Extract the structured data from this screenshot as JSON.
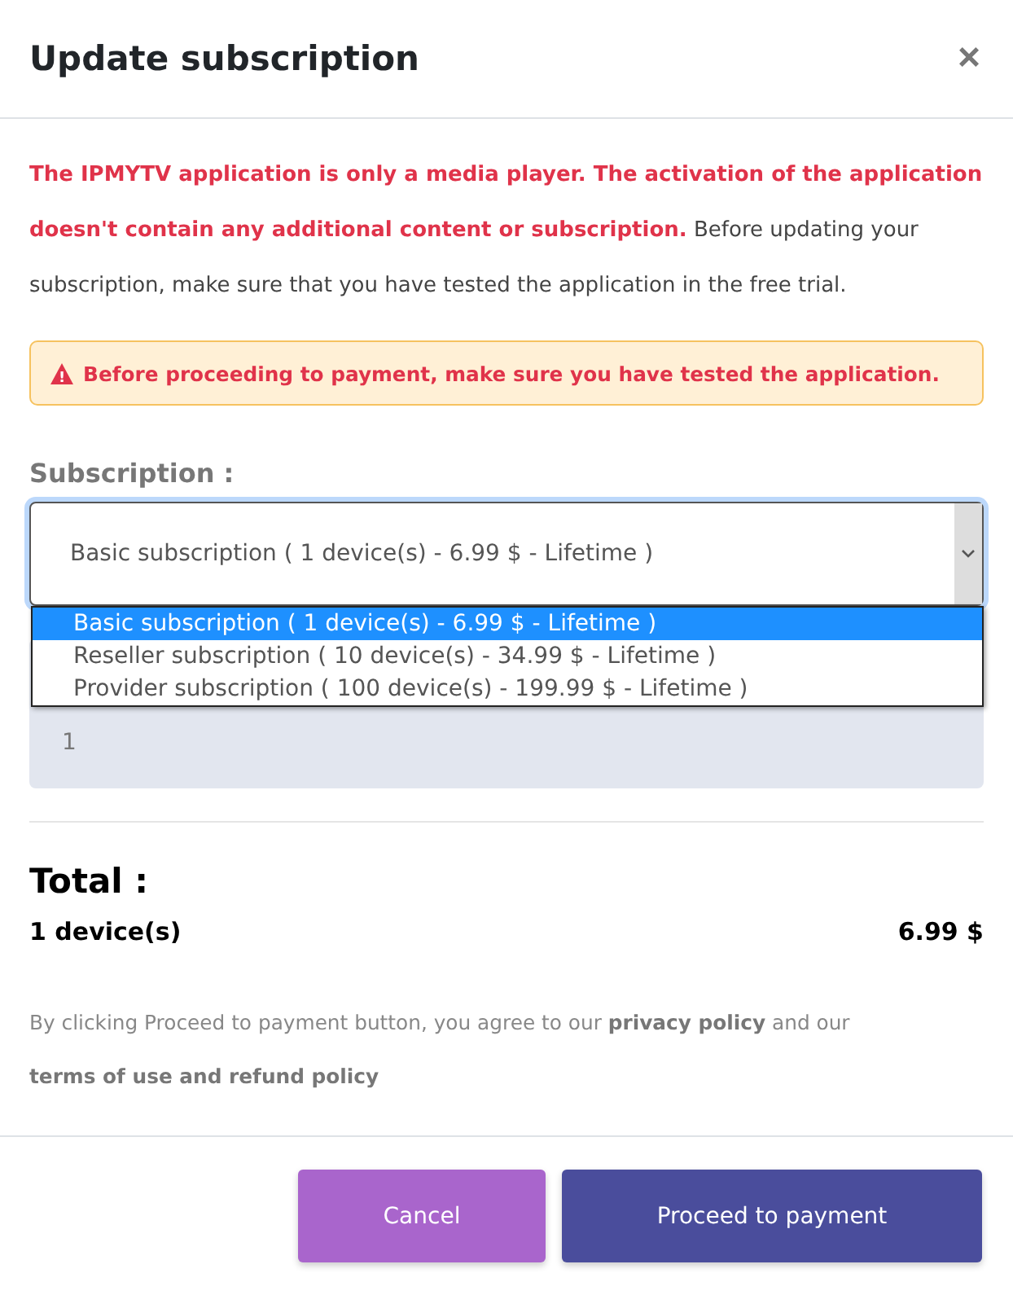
{
  "dialog": {
    "title": "Update subscription",
    "close": "×"
  },
  "intro": "**The IPMYTV application is only a media player. The activation of the application doesn't contain any additional content or subscription.** Before updating your subscription, make sure that you have tested the application in the free trial.",
  "alert": {
    "icon": "!",
    "text": "Before proceeding to payment, make sure you have tested the application."
  },
  "subscription": {
    "label": "Subscription :",
    "value": "Basic subscription ( 1 device(s) - 6.99 $ - Lifetime )",
    "expanded": true,
    "options": [
      {
        "label": "Basic subscription ( 1 device(s) - 6.99 $ - Lifetime )",
        "selected": true
      },
      {
        "label": "Reseller subscription ( 10 device(s) - 34.99 $ - Lifetime )",
        "selected": false
      },
      {
        "label": "Provider subscription ( 100 device(s) - 199.99 $ - Lifetime )",
        "selected": false
      }
    ]
  },
  "devices": {
    "value": "1"
  },
  "total": {
    "title": "Total :",
    "devices": "1 device(s)",
    "price": "6.99 $"
  },
  "agreement": "By clicking Proceed to payment button, you agree to our **privacy policy** and our\n**terms of use and refund policy**",
  "buttons": [
    {
      "label": "Cancel",
      "kind": "secondary"
    },
    {
      "label": "Proceed to payment",
      "kind": "primary"
    }
  ]
}
